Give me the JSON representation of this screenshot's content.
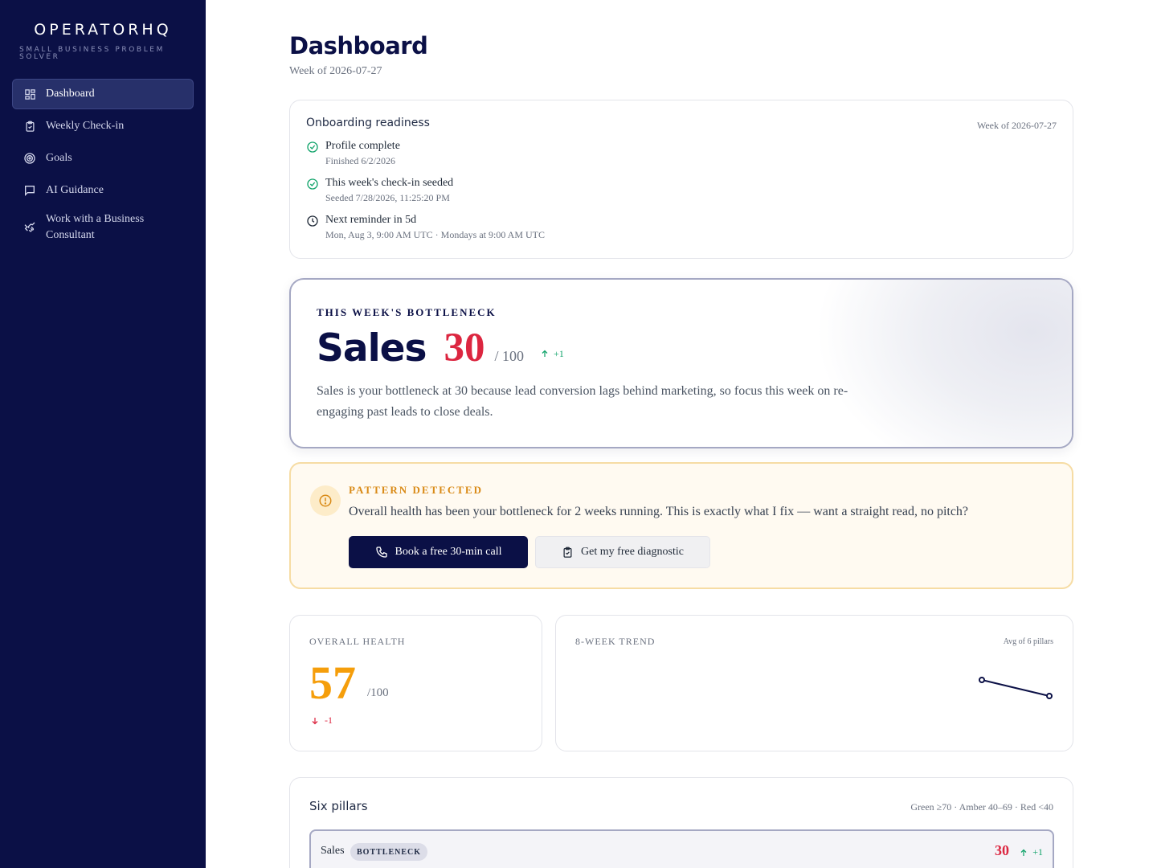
{
  "brand": {
    "name": "OPERATORHQ",
    "tagline": "SMALL BUSINESS PROBLEM SOLVER"
  },
  "nav": {
    "items": [
      {
        "label": "Dashboard",
        "icon": "dashboard-icon",
        "active": true
      },
      {
        "label": "Weekly Check-in",
        "icon": "clipboard-icon"
      },
      {
        "label": "Goals",
        "icon": "target-icon"
      },
      {
        "label": "AI Guidance",
        "icon": "chat-icon"
      },
      {
        "label": "Work with a Business Consultant",
        "icon": "handshake-icon"
      }
    ]
  },
  "header": {
    "title": "Dashboard",
    "subtitle": "Week of 2026-07-27"
  },
  "onboarding": {
    "title": "Onboarding readiness",
    "week": "Week of 2026-07-27",
    "items": [
      {
        "title": "Profile complete",
        "detail": "Finished 6/2/2026",
        "icon": "check-circle-icon",
        "color": "#10a36a"
      },
      {
        "title": "This week's check-in seeded",
        "detail": "Seeded 7/28/2026, 11:25:20 PM",
        "icon": "check-circle-icon",
        "color": "#10a36a"
      },
      {
        "title": "Next reminder in 5d",
        "detail": "Mon, Aug 3, 9:00 AM UTC · Mondays at 9:00 AM UTC",
        "icon": "clock-icon",
        "color": "#1f2937"
      }
    ]
  },
  "bottleneck": {
    "kicker": "THIS WEEK'S BOTTLENECK",
    "pillar": "Sales",
    "score": "30",
    "of": "/ 100",
    "delta": "+1",
    "description": "Sales is your bottleneck at 30 because lead conversion lags behind marketing, so focus this week on re-engaging past leads to close deals."
  },
  "pattern": {
    "kicker": "PATTERN DETECTED",
    "text": "Overall health has been your bottleneck for 2 weeks running. This is exactly what I fix — want a straight read, no pitch?",
    "primary_button": "Book a free 30-min call",
    "secondary_button": "Get my free diagnostic"
  },
  "health": {
    "label": "OVERALL HEALTH",
    "value": "57",
    "of": "/100",
    "delta": "-1"
  },
  "trend": {
    "label": "8-WEEK TREND",
    "note": "Avg of 6 pillars"
  },
  "chart_data": {
    "type": "line",
    "title": "8-WEEK TREND",
    "series": [
      {
        "values": [
          58,
          57
        ]
      }
    ],
    "ylim": [
      0,
      100
    ],
    "grid": false
  },
  "pillars": {
    "title": "Six pillars",
    "legend": "Green ≥70 · Amber 40–69 · Red <40",
    "rows": [
      {
        "name": "Sales",
        "badge": "BOTTLENECK",
        "score": "30",
        "delta": "+1"
      }
    ]
  },
  "colors": {
    "navy": "#0b1046",
    "red": "#dc2640",
    "amber": "#f59e0b",
    "green": "#10a36a"
  }
}
